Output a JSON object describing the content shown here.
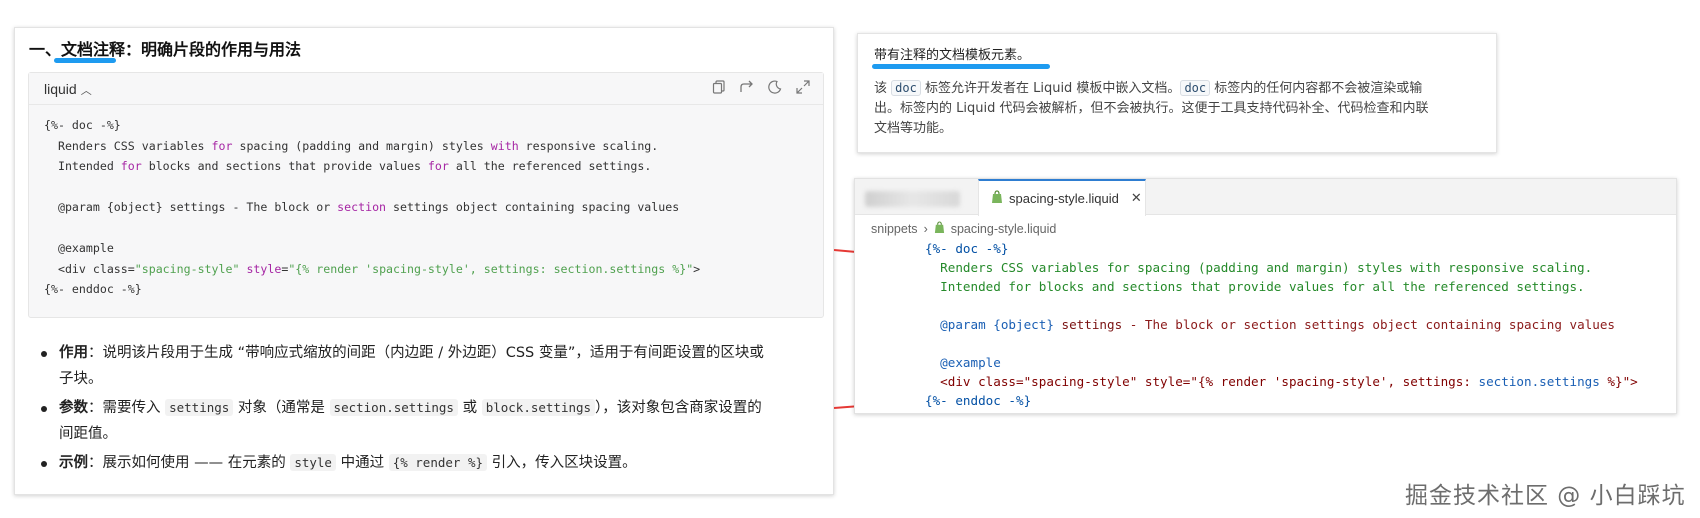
{
  "article": {
    "title_prefix": "一、",
    "title_em": "文档注释",
    "title_rest": "：明确片段的作用与用法",
    "code_lang": "liquid",
    "code_lines": [
      {
        "parts": [
          {
            "t": "{%- doc -%}"
          }
        ]
      },
      {
        "parts": [
          {
            "t": "  Renders CSS variables "
          },
          {
            "t": "for",
            "c": "kw"
          },
          {
            "t": " spacing (padding and margin) styles "
          },
          {
            "t": "with",
            "c": "kw"
          },
          {
            "t": " responsive scaling."
          }
        ]
      },
      {
        "parts": [
          {
            "t": "  Intended "
          },
          {
            "t": "for",
            "c": "kw"
          },
          {
            "t": " blocks and sections that provide values "
          },
          {
            "t": "for",
            "c": "kw"
          },
          {
            "t": " all the referenced settings."
          }
        ]
      },
      {
        "parts": [
          {
            "t": ""
          }
        ]
      },
      {
        "parts": [
          {
            "t": "  @param {object} settings - The block or "
          },
          {
            "t": "section",
            "c": "kw"
          },
          {
            "t": " settings object containing spacing values"
          }
        ]
      },
      {
        "parts": [
          {
            "t": ""
          }
        ]
      },
      {
        "parts": [
          {
            "t": "  @example"
          }
        ]
      },
      {
        "parts": [
          {
            "t": "  <div class="
          },
          {
            "t": "\"spacing-style\"",
            "c": "str"
          },
          {
            "t": " "
          },
          {
            "t": "style",
            "c": "kw"
          },
          {
            "t": "="
          },
          {
            "t": "\"{% render 'spacing-style', settings: section.settings %}\"",
            "c": "str"
          },
          {
            "t": ">"
          }
        ]
      },
      {
        "parts": [
          {
            "t": "{%- enddoc -%}"
          }
        ]
      }
    ],
    "bullets": [
      {
        "label": "作用",
        "l1_a": "：说明该片段用于生成 “带响应式缩放的间距（内边距 / 外边距）CSS 变量”，适用于有间距设置的区块或",
        "l2": "子块。"
      },
      {
        "label": "参数",
        "l1_a": "：需要传入 ",
        "code1": "settings",
        "l1_b": " 对象（通常是 ",
        "code2": "section.settings",
        "l1_c": " 或 ",
        "code3": "block.settings",
        "l1_d": "），该对象包含商家设置的",
        "l2": "间距值。"
      },
      {
        "label": "示例",
        "l1_a": "：展示如何使用 —— 在元素的 ",
        "code1": "style",
        "l1_b": " 中通过 ",
        "code2": "{% render %}",
        "l1_c": " 引入，传入区块设置。"
      }
    ]
  },
  "doc_card": {
    "heading": "带有注释的文档模板元素。",
    "p_a": "该 ",
    "code1": "doc",
    "p_b": " 标签允许开发者在 Liquid 模板中嵌入文档。",
    "code2": "doc",
    "p_c": " 标签内的任何内容都不会被渲染或输",
    "line2": "出。标签内的 Liquid 代码会被解析，但不会被执行。这便于工具支持代码补全、代码检查和内联",
    "line3": "文档等功能。"
  },
  "editor": {
    "tab_label": "spacing-style.liquid",
    "crumb_folder": "snippets",
    "crumb_file": "spacing-style.liquid",
    "lines": [
      {
        "parts": [
          {
            "t": "{%- doc -%}",
            "c": "e-tag"
          }
        ]
      },
      {
        "parts": [
          {
            "t": "  Renders CSS variables for spacing (padding and margin) styles with responsive scaling.",
            "c": "e-grn"
          }
        ]
      },
      {
        "parts": [
          {
            "t": "  Intended for blocks and sections that provide values for all the referenced settings.",
            "c": "e-grn"
          }
        ]
      },
      {
        "parts": [
          {
            "t": ""
          }
        ]
      },
      {
        "parts": [
          {
            "t": "  @param",
            "c": "e-par"
          },
          {
            "t": " {object}",
            "c": "e-par"
          },
          {
            "t": " settings",
            "c": "e-name"
          },
          {
            "t": " - The block or section settings object containing spacing values",
            "c": "e-mrn"
          }
        ]
      },
      {
        "parts": [
          {
            "t": ""
          }
        ]
      },
      {
        "parts": [
          {
            "t": "  @example",
            "c": "e-par"
          }
        ]
      },
      {
        "parts": [
          {
            "t": "  <div class=\"spacing-style\" style=\"{% render 'spacing-style', settings: ",
            "c": "e-kw"
          },
          {
            "t": "section.settings",
            "c": "e-par"
          },
          {
            "t": " %}\">",
            "c": "e-kw"
          }
        ]
      },
      {
        "parts": [
          {
            "t": "{%- enddoc -%}",
            "c": "e-tag"
          }
        ]
      }
    ]
  },
  "watermark": "掘金技术社区 @ 小白踩坑",
  "colors": {
    "accent_blue": "#1e9bf0",
    "arrow_red": "#e53935",
    "tab_border": "#2e7dd1"
  },
  "icons": [
    "copy-icon",
    "wrap-icon",
    "theme-icon",
    "expand-icon",
    "chevron-up-icon",
    "shopify-icon",
    "close-icon",
    "chevron-right-icon"
  ]
}
